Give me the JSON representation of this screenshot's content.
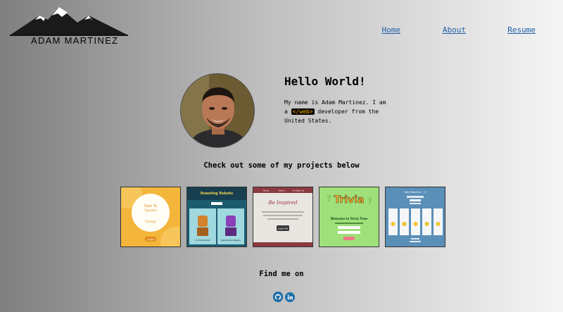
{
  "brand": {
    "name": "ADAM MARTINEZ"
  },
  "nav": {
    "items": [
      "Home",
      "About",
      "Resume"
    ]
  },
  "hero": {
    "heading": "Hello World!",
    "bio_before": "My name is Adam Martinez. I am a",
    "bio_tag": "</web>",
    "bio_after": "developer from the United States."
  },
  "projects": {
    "heading": "Check out some of my projects below",
    "cards": [
      {
        "name": "orange-project",
        "texts": [
          "Ripe To",
          "Squeeze",
          "Orange",
          "START"
        ]
      },
      {
        "name": "robot-project",
        "texts": [
          "Roasting Robots",
          "Ochre Rocket",
          "Alexandros Rogers"
        ]
      },
      {
        "name": "be-inspired-project",
        "texts": [
          "Home",
          "About",
          "Contact Us",
          "Be Inspired",
          "Inspire Me"
        ]
      },
      {
        "name": "trivia-project",
        "texts": [
          "Trivia",
          "Welcome to Trivia Time"
        ]
      },
      {
        "name": "dev-weather-project",
        "texts": [
          "<Dev/Weather />"
        ]
      }
    ]
  },
  "footer": {
    "heading": "Find me on",
    "links": [
      "github-icon",
      "linkedin-icon"
    ]
  },
  "colors": {
    "link": "#1e5fa8",
    "tag_bg": "#000000",
    "tag_fg": "#ffb000"
  }
}
